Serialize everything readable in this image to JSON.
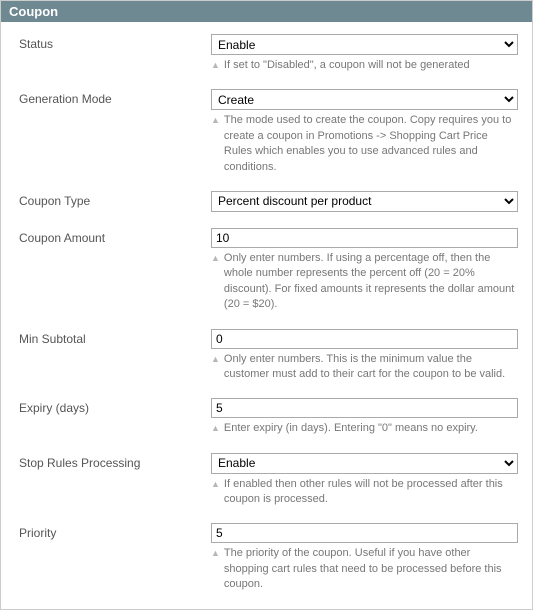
{
  "panel": {
    "title": "Coupon"
  },
  "fields": {
    "status": {
      "label": "Status",
      "value": "Enable",
      "hint": "If set to \"Disabled\", a coupon will not be generated"
    },
    "generation_mode": {
      "label": "Generation Mode",
      "value": "Create",
      "hint": "The mode used to create the coupon. Copy requires you to create a coupon in Promotions -> Shopping Cart Price Rules which enables you to use advanced rules and conditions."
    },
    "coupon_type": {
      "label": "Coupon Type",
      "value": "Percent discount per product"
    },
    "coupon_amount": {
      "label": "Coupon Amount",
      "value": "10",
      "hint": "Only enter numbers. If using a percentage off, then the whole number represents the percent off (20 = 20% discount). For fixed amounts it represents the dollar amount (20 = $20)."
    },
    "min_subtotal": {
      "label": "Min Subtotal",
      "value": "0",
      "hint": "Only enter numbers. This is the minimum value the customer must add to their cart for the coupon to be valid."
    },
    "expiry": {
      "label": "Expiry (days)",
      "value": "5",
      "hint": "Enter expiry (in days). Entering \"0\" means no expiry."
    },
    "stop_rules": {
      "label": "Stop Rules Processing",
      "value": "Enable",
      "hint": "If enabled then other rules will not be processed after this coupon is processed."
    },
    "priority": {
      "label": "Priority",
      "value": "5",
      "hint": "The priority of the coupon. Useful if you have other shopping cart rules that need to be processed before this coupon."
    }
  }
}
